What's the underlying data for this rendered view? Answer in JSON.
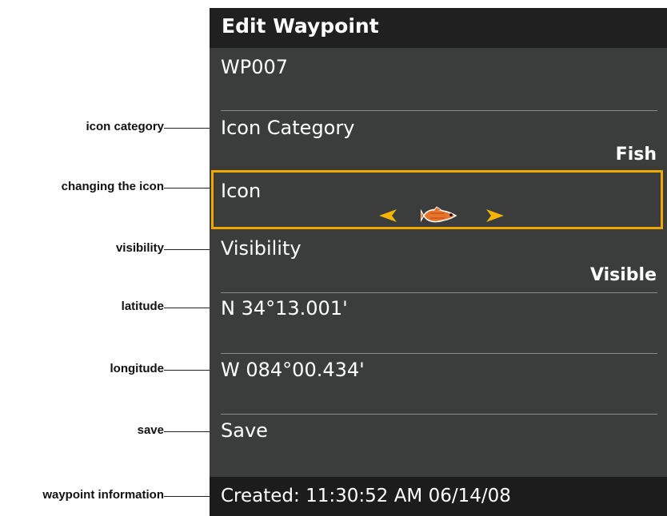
{
  "window": {
    "title": "Edit Waypoint"
  },
  "waypoint": {
    "name": "WP007",
    "icon_category_label": "Icon Category",
    "icon_category_value": "Fish",
    "icon_label": "Icon",
    "icon_name": "fish-icon",
    "visibility_label": "Visibility",
    "visibility_value": "Visible",
    "latitude": "N 34°13.001'",
    "longitude": "W 084°00.434'",
    "save_label": "Save",
    "created_info": "Created: 11:30:52 AM 06/14/08"
  },
  "callouts": {
    "icon_category": "icon category",
    "changing_icon": "changing the icon",
    "visibility": "visibility",
    "latitude": "latitude",
    "longitude": "longitude",
    "save": "save",
    "waypoint_information": "waypoint information"
  },
  "colors": {
    "screen_background": "#3b3d3d",
    "title_bar": "#202020",
    "footer_bar": "#1c1c1c",
    "selection_border": "#f0a800",
    "arrow_fill": "#f5b400",
    "text": "#ffffff"
  }
}
